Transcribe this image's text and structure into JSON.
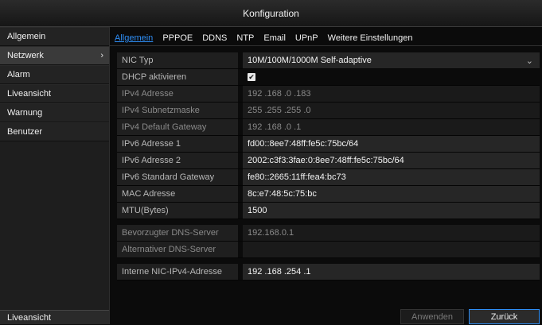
{
  "window": {
    "title": "Konfiguration"
  },
  "sidebar": {
    "items": [
      {
        "label": "Allgemein"
      },
      {
        "label": "Netzwerk",
        "active": true
      },
      {
        "label": "Alarm"
      },
      {
        "label": "Liveansicht"
      },
      {
        "label": "Warnung"
      },
      {
        "label": "Benutzer"
      }
    ],
    "footer": "Liveansicht"
  },
  "tabs": [
    "Allgemein",
    "PPPOE",
    "DDNS",
    "NTP",
    "Email",
    "UPnP",
    "Weitere Einstellungen"
  ],
  "form": {
    "nic_type": {
      "label": "NIC Typ",
      "value": "10M/100M/1000M Self-adaptive"
    },
    "dhcp": {
      "label": "DHCP aktivieren",
      "checked": true,
      "check_glyph": "✔"
    },
    "ipv4": {
      "label": "IPv4 Adresse",
      "value": "192 .168 .0    .183"
    },
    "mask": {
      "label": "IPv4 Subnetzmaske",
      "value": "255 .255 .255 .0"
    },
    "gw4": {
      "label": "IPv4 Default Gateway",
      "value": "192 .168 .0    .1"
    },
    "ipv6_1": {
      "label": "IPv6 Adresse 1",
      "value": "fd00::8ee7:48ff:fe5c:75bc/64"
    },
    "ipv6_2": {
      "label": "IPv6 Adresse 2",
      "value": "2002:c3f3:3fae:0:8ee7:48ff:fe5c:75bc/64"
    },
    "gw6": {
      "label": "IPv6 Standard Gateway",
      "value": "fe80::2665:11ff:fea4:bc73"
    },
    "mac": {
      "label": "MAC Adresse",
      "value": "8c:e7:48:5c:75:bc"
    },
    "mtu": {
      "label": "MTU(Bytes)",
      "value": "1500"
    },
    "dns1": {
      "label": "Bevorzugter DNS-Server",
      "value": "192.168.0.1"
    },
    "dns2": {
      "label": "Alternativer DNS-Server",
      "value": ""
    },
    "nic_ipv4": {
      "label": "Interne NIC-IPv4-Adresse",
      "value": "192 .168 .254 .1"
    }
  },
  "buttons": {
    "apply": "Anwenden",
    "back": "Zurück"
  },
  "icons": {
    "dropdown": "⌄",
    "chevron": "›"
  }
}
